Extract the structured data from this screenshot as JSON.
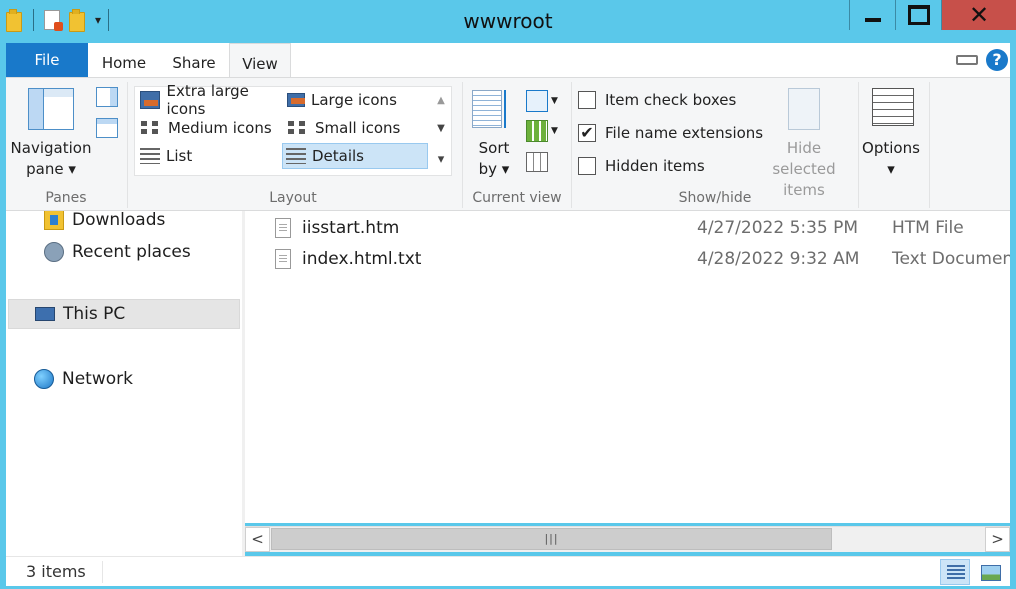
{
  "window": {
    "title": "wwwroot"
  },
  "quick_access": {
    "icons": [
      "folder-icon",
      "properties-icon",
      "new-folder-icon"
    ],
    "dropdown": "▾"
  },
  "caption": {
    "close": "✕"
  },
  "tabs": [
    {
      "label": "File",
      "active": false
    },
    {
      "label": "Home",
      "active": false
    },
    {
      "label": "Share",
      "active": false
    },
    {
      "label": "View",
      "active": true
    }
  ],
  "ribbon": {
    "help": "?",
    "panes": {
      "label": "Panes",
      "navigation_pane_line1": "Navigation",
      "navigation_pane_line2": "pane ▾"
    },
    "layout": {
      "label": "Layout",
      "options": [
        {
          "label": "Extra large icons",
          "icon": "extra-large-icons-icon",
          "selected": false
        },
        {
          "label": "Large icons",
          "icon": "large-icons-icon",
          "selected": false
        },
        {
          "label": "Medium icons",
          "icon": "medium-icons-icon",
          "selected": false
        },
        {
          "label": "Small icons",
          "icon": "small-icons-icon",
          "selected": false
        },
        {
          "label": "List",
          "icon": "list-icon",
          "selected": false
        },
        {
          "label": "Details",
          "icon": "details-icon",
          "selected": true
        }
      ],
      "scroll_up": "▲",
      "scroll_down": "▼",
      "more": "▾"
    },
    "current_view": {
      "label": "Current view",
      "sort_line1": "Sort",
      "sort_line2": "by ▾",
      "dropdown": "▼"
    },
    "show_hide": {
      "label": "Show/hide",
      "checkboxes": [
        {
          "label": "Item check boxes",
          "checked": false
        },
        {
          "label": "File name extensions",
          "checked": true
        },
        {
          "label": "Hidden items",
          "checked": false
        }
      ],
      "check_mark": "✔",
      "hide_selected_line1": "Hide selected",
      "hide_selected_line2": "items"
    },
    "options": {
      "label": "Options",
      "dropdown": "▾"
    }
  },
  "navigation": [
    {
      "label": "Downloads",
      "icon": "downloads-folder-icon",
      "selected": false
    },
    {
      "label": "Recent places",
      "icon": "recent-places-icon",
      "selected": false
    },
    {
      "label": "This PC",
      "icon": "computer-icon",
      "selected": true
    },
    {
      "label": "Network",
      "icon": "network-icon",
      "selected": false
    }
  ],
  "files": [
    {
      "name": "iisstart.htm",
      "date": "4/27/2022 5:35 PM",
      "type": "HTM File"
    },
    {
      "name": "index.html.txt",
      "date": "4/28/2022 9:32 AM",
      "type": "Text Document"
    }
  ],
  "scrollbar": {
    "left": "<",
    "right": ">",
    "grip": "|||"
  },
  "status": {
    "items_count": "3 items"
  }
}
